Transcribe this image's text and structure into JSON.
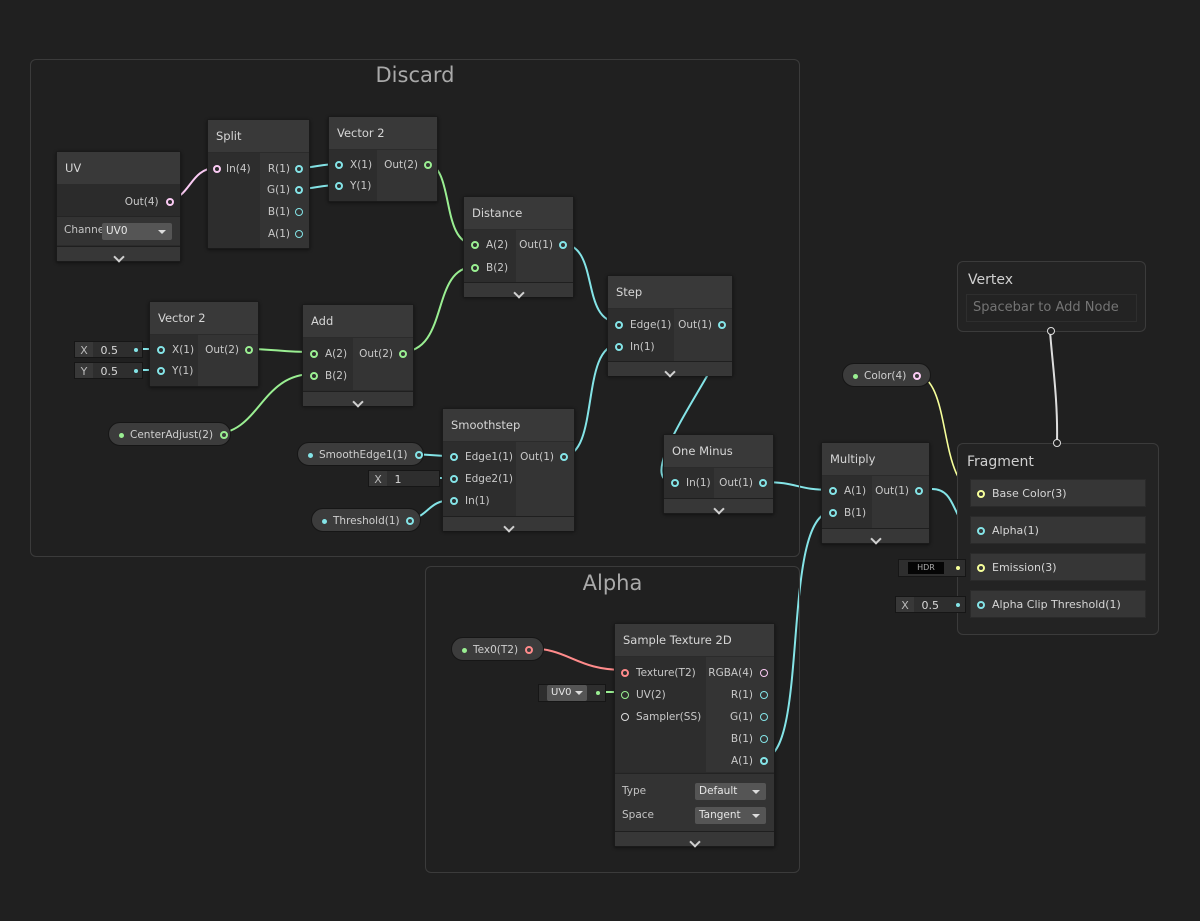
{
  "groups": {
    "discard": "Discard",
    "alpha": "Alpha"
  },
  "nodes": {
    "uv": {
      "title": "UV",
      "out": "Out(4)",
      "channel_label": "Channel",
      "channel_value": "UV0"
    },
    "split": {
      "title": "Split",
      "in": "In(4)",
      "outs": [
        "R(1)",
        "G(1)",
        "B(1)",
        "A(1)"
      ]
    },
    "vector2_top": {
      "title": "Vector 2",
      "ins": [
        "X(1)",
        "Y(1)"
      ],
      "out": "Out(2)"
    },
    "distance": {
      "title": "Distance",
      "ins": [
        "A(2)",
        "B(2)"
      ],
      "out": "Out(1)"
    },
    "step": {
      "title": "Step",
      "ins": [
        "Edge(1)",
        "In(1)"
      ],
      "out": "Out(1)"
    },
    "vector2_left": {
      "title": "Vector 2",
      "ins": [
        "X(1)",
        "Y(1)"
      ],
      "out": "Out(2)"
    },
    "add": {
      "title": "Add",
      "ins": [
        "A(2)",
        "B(2)"
      ],
      "out": "Out(2)"
    },
    "smoothstep": {
      "title": "Smoothstep",
      "ins": [
        "Edge1(1)",
        "Edge2(1)",
        "In(1)"
      ],
      "out": "Out(1)"
    },
    "one_minus": {
      "title": "One Minus",
      "in": "In(1)",
      "out": "Out(1)"
    },
    "multiply": {
      "title": "Multiply",
      "ins": [
        "A(1)",
        "B(1)"
      ],
      "out": "Out(1)"
    },
    "sample_texture": {
      "title": "Sample Texture 2D",
      "ins": [
        "Texture(T2)",
        "UV(2)",
        "Sampler(SS)"
      ],
      "outs": [
        "RGBA(4)",
        "R(1)",
        "G(1)",
        "B(1)",
        "A(1)"
      ],
      "type_label": "Type",
      "type_value": "Default",
      "space_label": "Space",
      "space_value": "Tangent"
    }
  },
  "inline_inputs": {
    "v2_x_label": "X",
    "v2_x_value": "0.5",
    "v2_y_label": "Y",
    "v2_y_value": "0.5",
    "edge2_label": "X",
    "edge2_value": "1",
    "uv_select": "UV0",
    "hdr": "HDR",
    "clip_label": "X",
    "clip_value": "0.5"
  },
  "properties": {
    "center_adjust": "CenterAdjust(2)",
    "smooth_edge": "SmoothEdge1(1)",
    "threshold": "Threshold(1)",
    "color": "Color(4)",
    "tex0": "Tex0(T2)"
  },
  "master": {
    "vertex_title": "Vertex",
    "vertex_placeholder": "Spacebar to Add Node",
    "fragment_title": "Fragment",
    "slots": [
      "Base Color(3)",
      "Alpha(1)",
      "Emission(3)",
      "Alpha Clip Threshold(1)"
    ]
  },
  "colors": {
    "background": "#202020",
    "vector1": "#84e4e7",
    "vector2": "#9aef92",
    "vector3": "#f6ff9a",
    "vector4": "#fbcbf4",
    "texture": "#ff8b8b",
    "sampler": "#dddddd"
  }
}
